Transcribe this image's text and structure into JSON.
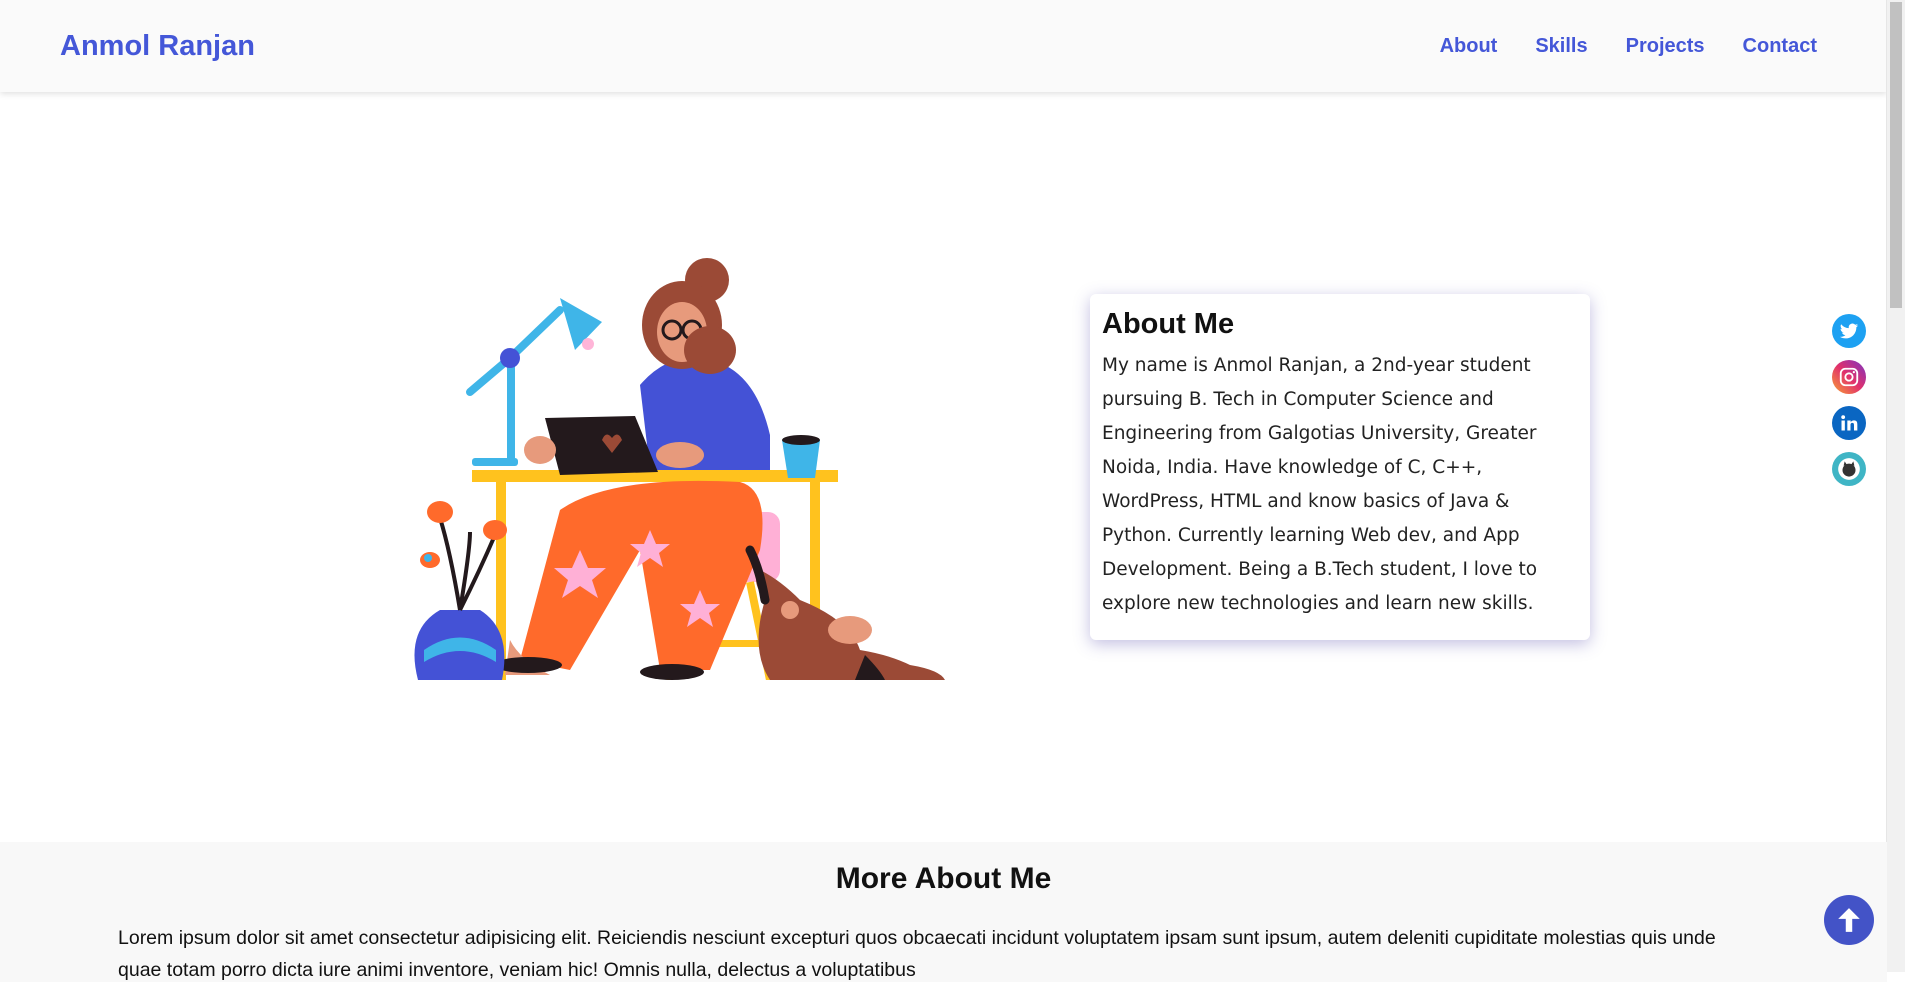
{
  "header": {
    "brand": "Anmol Ranjan",
    "nav": [
      "About",
      "Skills",
      "Projects",
      "Contact"
    ]
  },
  "about": {
    "title": "About Me",
    "text": "My name is Anmol Ranjan, a 2nd-year student pursuing B. Tech in Computer Science and Engineering from Galgotias University, Greater Noida, India. Have knowledge of C, C++, WordPress, HTML and know basics of Java & Python. Currently learning Web dev, and App Development. Being a B.Tech student, I love to explore new technologies and learn new skills."
  },
  "socials": [
    {
      "icon": "twitter-icon",
      "color": "#1da1f2"
    },
    {
      "icon": "instagram-icon",
      "color": "#e1306c"
    },
    {
      "icon": "linkedin-icon",
      "color": "#0a66c2"
    },
    {
      "icon": "github-icon",
      "color": "#3fb5c5"
    }
  ],
  "more": {
    "title": "More About Me",
    "text": "Lorem ipsum dolor sit amet consectetur adipisicing elit. Reiciendis nesciunt excepturi quos obcaecati incidunt voluptatem ipsam sunt ipsum, autem deleniti cupiditate molestias quis unde quae totam porro dicta iure animi inventore, veniam hic! Omnis nulla, delectus a voluptatibus"
  },
  "colors": {
    "accent": "#4457d8",
    "to_top": "#4353c7"
  },
  "to_top_icon": "arrow-up-icon"
}
